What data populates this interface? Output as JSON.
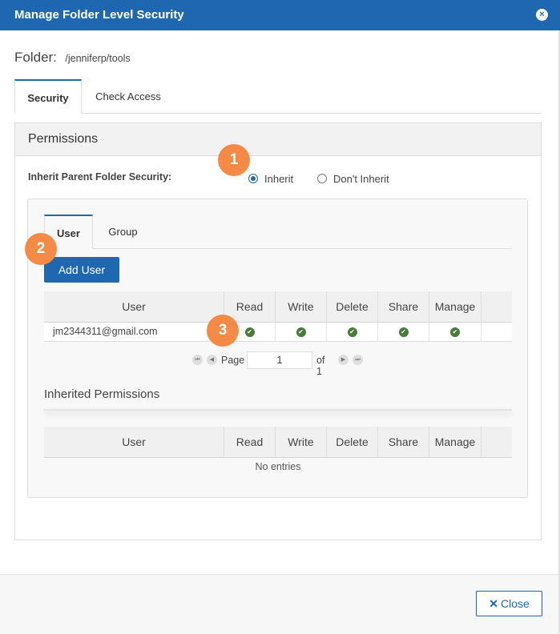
{
  "dialog": {
    "title": "Manage Folder Level Security",
    "close_icon": "×"
  },
  "folder": {
    "label": "Folder:",
    "path": "/jenniferp/tools"
  },
  "main_tabs": [
    {
      "label": "Security",
      "active": true
    },
    {
      "label": "Check Access",
      "active": false
    }
  ],
  "permissions": {
    "header": "Permissions",
    "inherit_label": "Inherit Parent Folder Security:",
    "options": [
      {
        "label": "Inherit",
        "selected": true
      },
      {
        "label": "Don't Inherit",
        "selected": false
      }
    ],
    "sub_tabs": [
      {
        "label": "User",
        "active": true
      },
      {
        "label": "Group",
        "active": false
      }
    ],
    "add_user_label": "Add User",
    "columns": [
      "User",
      "Read",
      "Write",
      "Delete",
      "Share",
      "Manage"
    ],
    "rows": [
      {
        "user": "jm2344311@gmail.com",
        "read": true,
        "write": true,
        "delete": true,
        "share": true,
        "manage": true
      }
    ],
    "pager": {
      "page_label": "Page",
      "page": "1",
      "of_label": "of 1"
    },
    "inherited": {
      "title": "Inherited Permissions",
      "columns": [
        "User",
        "Read",
        "Write",
        "Delete",
        "Share",
        "Manage"
      ],
      "empty_text": "No entries"
    }
  },
  "badges": [
    "1",
    "2",
    "3"
  ],
  "footer": {
    "close_label": "Close",
    "close_icon": "✕"
  },
  "colors": {
    "primary": "#1f67b1",
    "badge": "#f58a47",
    "check": "#4a7a3c"
  }
}
